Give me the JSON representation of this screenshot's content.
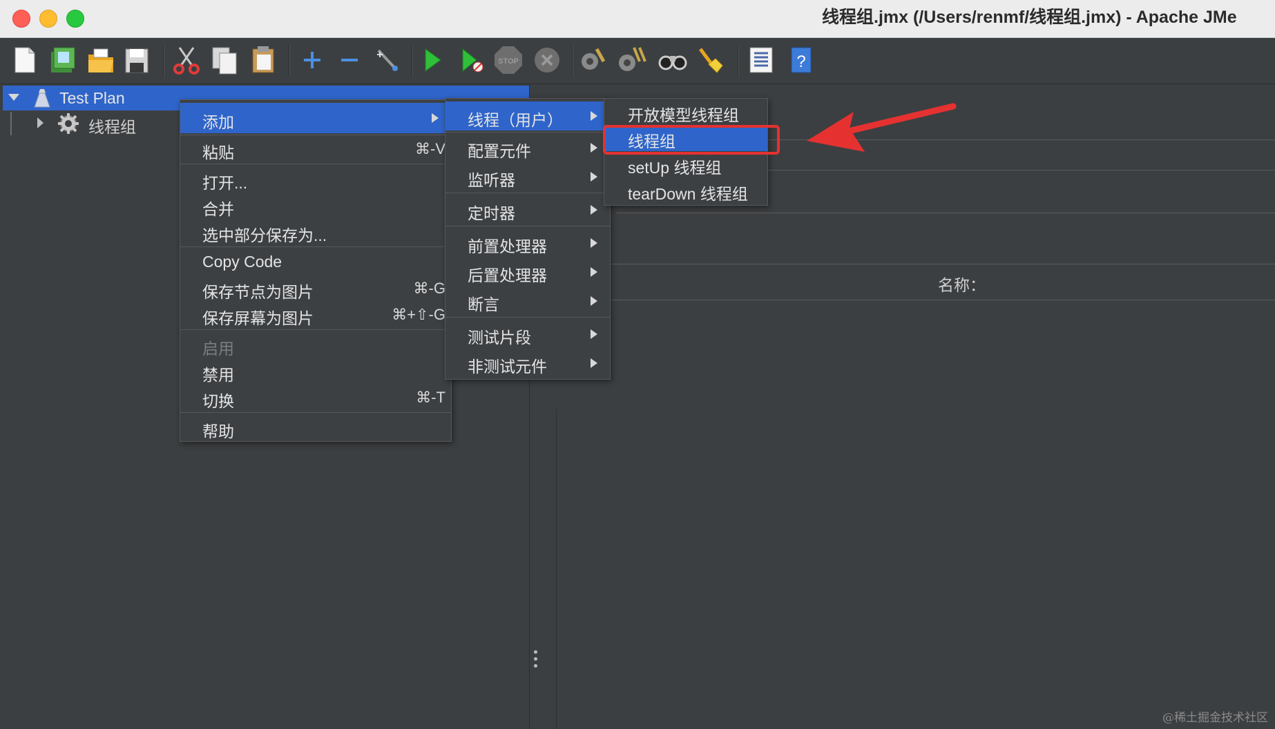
{
  "window": {
    "title": "线程组.jmx (/Users/renmf/线程组.jmx) - Apache JMe",
    "traffic_lights": {
      "close": "#fe5f57",
      "minimize": "#febc2e",
      "zoom": "#28c840"
    }
  },
  "toolbar": {
    "buttons": [
      {
        "name": "new-icon"
      },
      {
        "name": "templates-icon"
      },
      {
        "name": "open-icon"
      },
      {
        "name": "save-icon"
      },
      {
        "name": "cut-icon"
      },
      {
        "name": "copy-icon"
      },
      {
        "name": "paste-icon"
      },
      {
        "name": "expand-icon"
      },
      {
        "name": "collapse-icon"
      },
      {
        "name": "toggle-icon"
      },
      {
        "name": "start-icon"
      },
      {
        "name": "start-no-pause-icon"
      },
      {
        "name": "stop-icon"
      },
      {
        "name": "shutdown-icon"
      },
      {
        "name": "clear-icon"
      },
      {
        "name": "clear-all-icon"
      },
      {
        "name": "search-icon"
      },
      {
        "name": "reset-search-icon"
      },
      {
        "name": "function-helper-icon"
      },
      {
        "name": "help-icon"
      }
    ],
    "stop_label": "STOP"
  },
  "tree": {
    "root": {
      "label": "Test Plan",
      "icon": "test-plan-icon",
      "selected": true
    },
    "children": [
      {
        "label": "线程组",
        "icon": "gear-icon"
      }
    ]
  },
  "context_menu": {
    "items": [
      {
        "label": "添加",
        "has_submenu": true,
        "selected": true
      },
      {
        "label": "粘贴",
        "shortcut": "⌘-V"
      },
      {
        "label": "打开..."
      },
      {
        "label": "合并"
      },
      {
        "label": "选中部分保存为..."
      },
      {
        "label": "Copy Code"
      },
      {
        "label": "保存节点为图片",
        "shortcut": "⌘-G"
      },
      {
        "label": "保存屏幕为图片",
        "shortcut": "⌘+⇧-G"
      },
      {
        "label": "启用",
        "disabled": true
      },
      {
        "label": "禁用"
      },
      {
        "label": "切换",
        "shortcut": "⌘-T"
      },
      {
        "label": "帮助"
      }
    ]
  },
  "add_submenu": {
    "items": [
      {
        "label": "线程（用户）",
        "selected": true
      },
      {
        "label": "配置元件"
      },
      {
        "label": "监听器"
      },
      {
        "label": "定时器"
      },
      {
        "label": "前置处理器"
      },
      {
        "label": "后置处理器"
      },
      {
        "label": "断言"
      },
      {
        "label": "测试片段"
      },
      {
        "label": "非测试元件"
      }
    ]
  },
  "threads_submenu": {
    "items": [
      {
        "label": "开放模型线程组"
      },
      {
        "label": "线程组",
        "selected": true
      },
      {
        "label": "setUp 线程组"
      },
      {
        "label": "tearDown 线程组"
      }
    ]
  },
  "right_panel": {
    "name_label": "名称："
  },
  "annotation": {
    "color": "#e63131"
  },
  "watermark": "@稀土掘金技术社区",
  "colors": {
    "background": "#3c3f41",
    "selection": "#2f65ca",
    "menu": "#3d4043"
  }
}
